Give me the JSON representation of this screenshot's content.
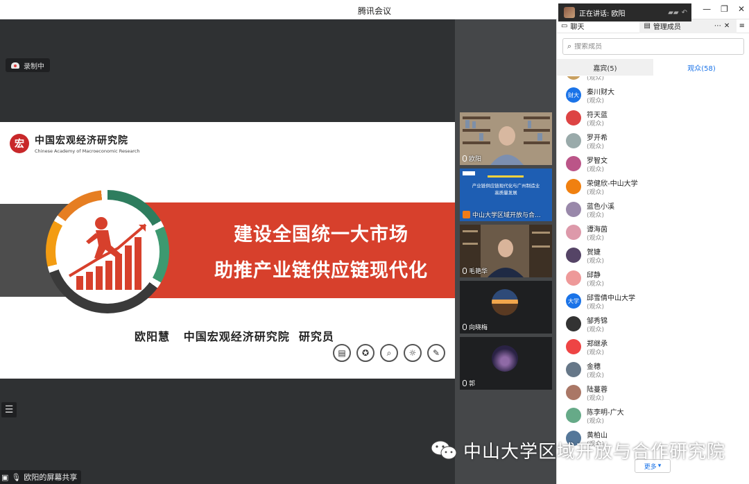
{
  "window": {
    "title": "腾讯会议"
  },
  "speaking": {
    "label": "正在讲话: 欧阳"
  },
  "stage": {
    "recording_label": "录制中",
    "share_label": "欧阳的屏幕共享"
  },
  "slide": {
    "org_cn": "中国宏观经济研究院",
    "org_en": "Chinese Academy of Macroeconomic Research",
    "title_line1": "建设全国统一大市场",
    "title_line2": "助推产业链供应链现代化",
    "presenter": "欧阳慧   中国宏观经济研究院  研究员",
    "icons": [
      "book-icon",
      "award-icon",
      "magnifier-icon",
      "lightbulb-icon",
      "checklist-icon"
    ]
  },
  "video_tiles": [
    {
      "name": "欧阳"
    },
    {
      "name": "中山大学区域开放与合...",
      "slide_lines": [
        "产业链供应链现代化与广州制造业",
        "高质量发展"
      ]
    },
    {
      "name": "毛艳华"
    },
    {
      "name": "向晓梅"
    },
    {
      "name": "郭"
    }
  ],
  "panel": {
    "tab_chat": "聊天",
    "tab_members": "管理成员",
    "search_placeholder": "搜索成员",
    "tab_guests": "嘉宾(5)",
    "tab_audience": "观众(58)",
    "more": "更多",
    "members": [
      {
        "name": "",
        "role": "(观众)",
        "color": "#c8a060"
      },
      {
        "name": "秦川财大",
        "role": "(观众)",
        "color": "#1a73e8",
        "badge": "财大"
      },
      {
        "name": "符天蓝",
        "role": "(观众)",
        "color": "#d44"
      },
      {
        "name": "罗开希",
        "role": "(观众)",
        "color": "#9aa"
      },
      {
        "name": "罗智文",
        "role": "(观众)",
        "color": "#b58"
      },
      {
        "name": "荣健欣-中山大学",
        "role": "(观众)",
        "color": "#f08010"
      },
      {
        "name": "蓝色小溪",
        "role": "(观众)",
        "color": "#98a"
      },
      {
        "name": "谭海茵",
        "role": "(观众)",
        "color": "#d9a"
      },
      {
        "name": "贺婕",
        "role": "(观众)",
        "color": "#546"
      },
      {
        "name": "邱静",
        "role": "(观众)",
        "color": "#e99"
      },
      {
        "name": "邱雪倩中山大学",
        "role": "(观众)",
        "color": "#1a73e8",
        "badge": "大学"
      },
      {
        "name": "邹秀锦",
        "role": "(观众)",
        "color": "#333"
      },
      {
        "name": "郑继承",
        "role": "(观众)",
        "color": "#e44"
      },
      {
        "name": "金穗",
        "role": "(观众)",
        "color": "#678"
      },
      {
        "name": "陆蔓蓉",
        "role": "(观众)",
        "color": "#a76"
      },
      {
        "name": "陈李明-广大",
        "role": "(观众)",
        "color": "#6a8"
      },
      {
        "name": "黄柏山",
        "role": "(观众)",
        "color": "#579"
      }
    ]
  },
  "watermark": {
    "text": "中山大学区域开放与合作研究院"
  },
  "colors": {
    "accent": "#1a73e8",
    "slide_red": "#d7402c",
    "stage_bg": "#2f3133"
  }
}
